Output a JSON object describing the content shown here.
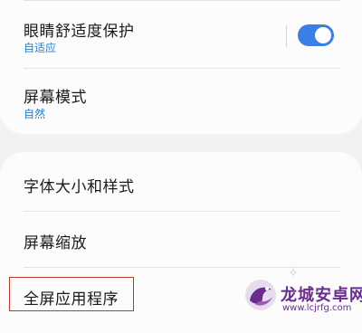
{
  "settings": {
    "eye_comfort": {
      "title": "眼睛舒适度保护",
      "subtitle": "自适应",
      "toggle_on": true
    },
    "screen_mode": {
      "title": "屏幕模式",
      "subtitle": "自然"
    },
    "font_size_style": {
      "title": "字体大小和样式"
    },
    "screen_zoom": {
      "title": "屏幕缩放"
    },
    "fullscreen_apps": {
      "title": "全屏应用程序"
    }
  },
  "watermark": {
    "title": "龙城安卓网",
    "url": "www.lcjrfg.com"
  },
  "colors": {
    "accent": "#3a7ee8",
    "subtitle": "#1f7ed6",
    "highlight": "#c0392b",
    "watermark": "#6a2c91"
  }
}
